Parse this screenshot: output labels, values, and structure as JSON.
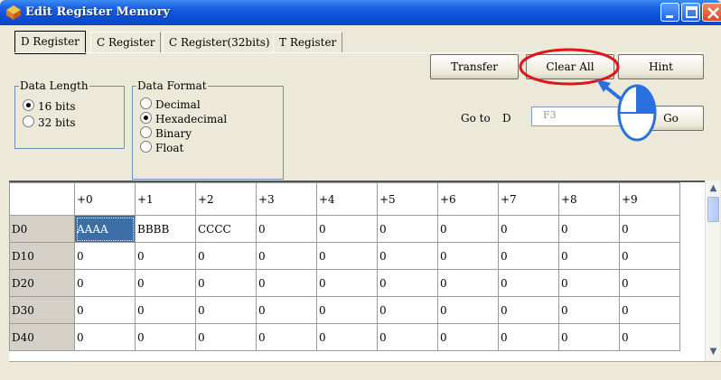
{
  "window": {
    "title": "Edit Register Memory"
  },
  "tabs": [
    {
      "label": "D Register",
      "active": true
    },
    {
      "label": "C Register",
      "active": false
    },
    {
      "label": "C Register(32bits)",
      "active": false
    },
    {
      "label": "T Register",
      "active": false
    }
  ],
  "toolbar": {
    "transfer_label": "Transfer",
    "clear_all_label": "Clear All",
    "hint_label": "Hint",
    "go_label": "Go"
  },
  "data_length": {
    "title": "Data Length",
    "options": [
      "16 bits",
      "32 bits"
    ],
    "selected": "16 bits"
  },
  "data_format": {
    "title": "Data Format",
    "options": [
      "Decimal",
      "Hexadecimal",
      "Binary",
      "Float"
    ],
    "selected": "Hexadecimal"
  },
  "goto": {
    "label": "Go to",
    "prefix": "D",
    "value": "F3"
  },
  "grid": {
    "columns": [
      "+0",
      "+1",
      "+2",
      "+3",
      "+4",
      "+5",
      "+6",
      "+7",
      "+8",
      "+9"
    ],
    "rows": [
      {
        "label": "D0",
        "values": [
          "AAAA",
          "BBBB",
          "CCCC",
          "0",
          "0",
          "0",
          "0",
          "0",
          "0",
          "0"
        ]
      },
      {
        "label": "D10",
        "values": [
          "0",
          "0",
          "0",
          "0",
          "0",
          "0",
          "0",
          "0",
          "0",
          "0"
        ]
      },
      {
        "label": "D20",
        "values": [
          "0",
          "0",
          "0",
          "0",
          "0",
          "0",
          "0",
          "0",
          "0",
          "0"
        ]
      },
      {
        "label": "D30",
        "values": [
          "0",
          "0",
          "0",
          "0",
          "0",
          "0",
          "0",
          "0",
          "0",
          "0"
        ]
      },
      {
        "label": "D40",
        "values": [
          "0",
          "0",
          "0",
          "0",
          "0",
          "0",
          "0",
          "0",
          "0",
          "0"
        ]
      }
    ],
    "selected_cell": "D0 +0"
  },
  "annotation": {
    "highlight_color": "#e0161b",
    "arrow_color": "#2a6fe0",
    "icon": "mouse-icon"
  }
}
